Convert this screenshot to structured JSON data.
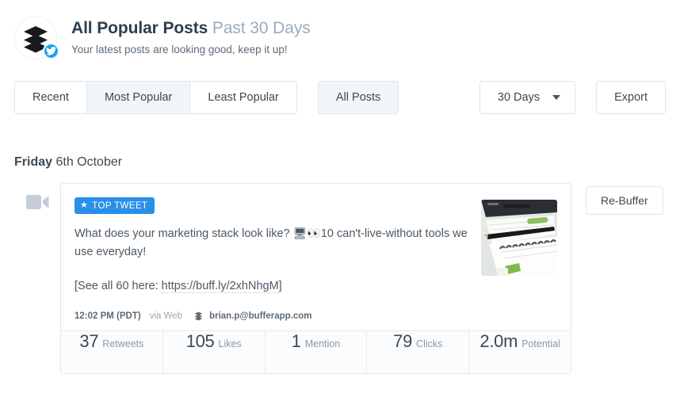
{
  "header": {
    "title_main": "All Popular Posts",
    "title_period": "Past 30 Days",
    "subtitle": "Your latest posts are looking good, keep it up!",
    "avatar_icon": "buffer-logo-icon",
    "network_badge_icon": "twitter-bird-icon",
    "brand_color": "#1da1f2"
  },
  "toolbar": {
    "sort_tabs": [
      {
        "label": "Recent",
        "active": false
      },
      {
        "label": "Most Popular",
        "active": true
      },
      {
        "label": "Least Popular",
        "active": false
      }
    ],
    "filter_label": "All Posts",
    "filter_active": true,
    "range_label": "30 Days",
    "range_caret_icon": "chevron-down-icon",
    "export_label": "Export"
  },
  "date_group": {
    "day_of_week": "Friday",
    "date": "6th October"
  },
  "post": {
    "media_type_icon": "video-camera-icon",
    "badge": {
      "icon": "star-icon",
      "label": "TOP TWEET",
      "color": "#2a8fe8"
    },
    "text_before_emoji": "What does your marketing stack look like? ",
    "emoji1": "🖥",
    "emoji2": "👀",
    "text_after_emoji": "10 can't-live-without tools we use everyday!",
    "link_prefix": "[See all 60 here: ",
    "link_url": "https://buff.ly/2xhNhgM",
    "link_suffix": "]",
    "meta": {
      "time": "12:02 PM (PDT)",
      "via": "via Web",
      "source_icon": "buffer-logo-icon",
      "account": "brian.p@bufferapp.com"
    },
    "thumbnail_alt": "desk-photo-notebook-pencil",
    "stats": [
      {
        "value": "37",
        "label": "Retweets"
      },
      {
        "value": "105",
        "label": "Likes"
      },
      {
        "value": "1",
        "label": "Mention"
      },
      {
        "value": "79",
        "label": "Clicks"
      },
      {
        "value": "2.0m",
        "label": "Potential"
      }
    ],
    "rebuffer_label": "Re-Buffer"
  }
}
